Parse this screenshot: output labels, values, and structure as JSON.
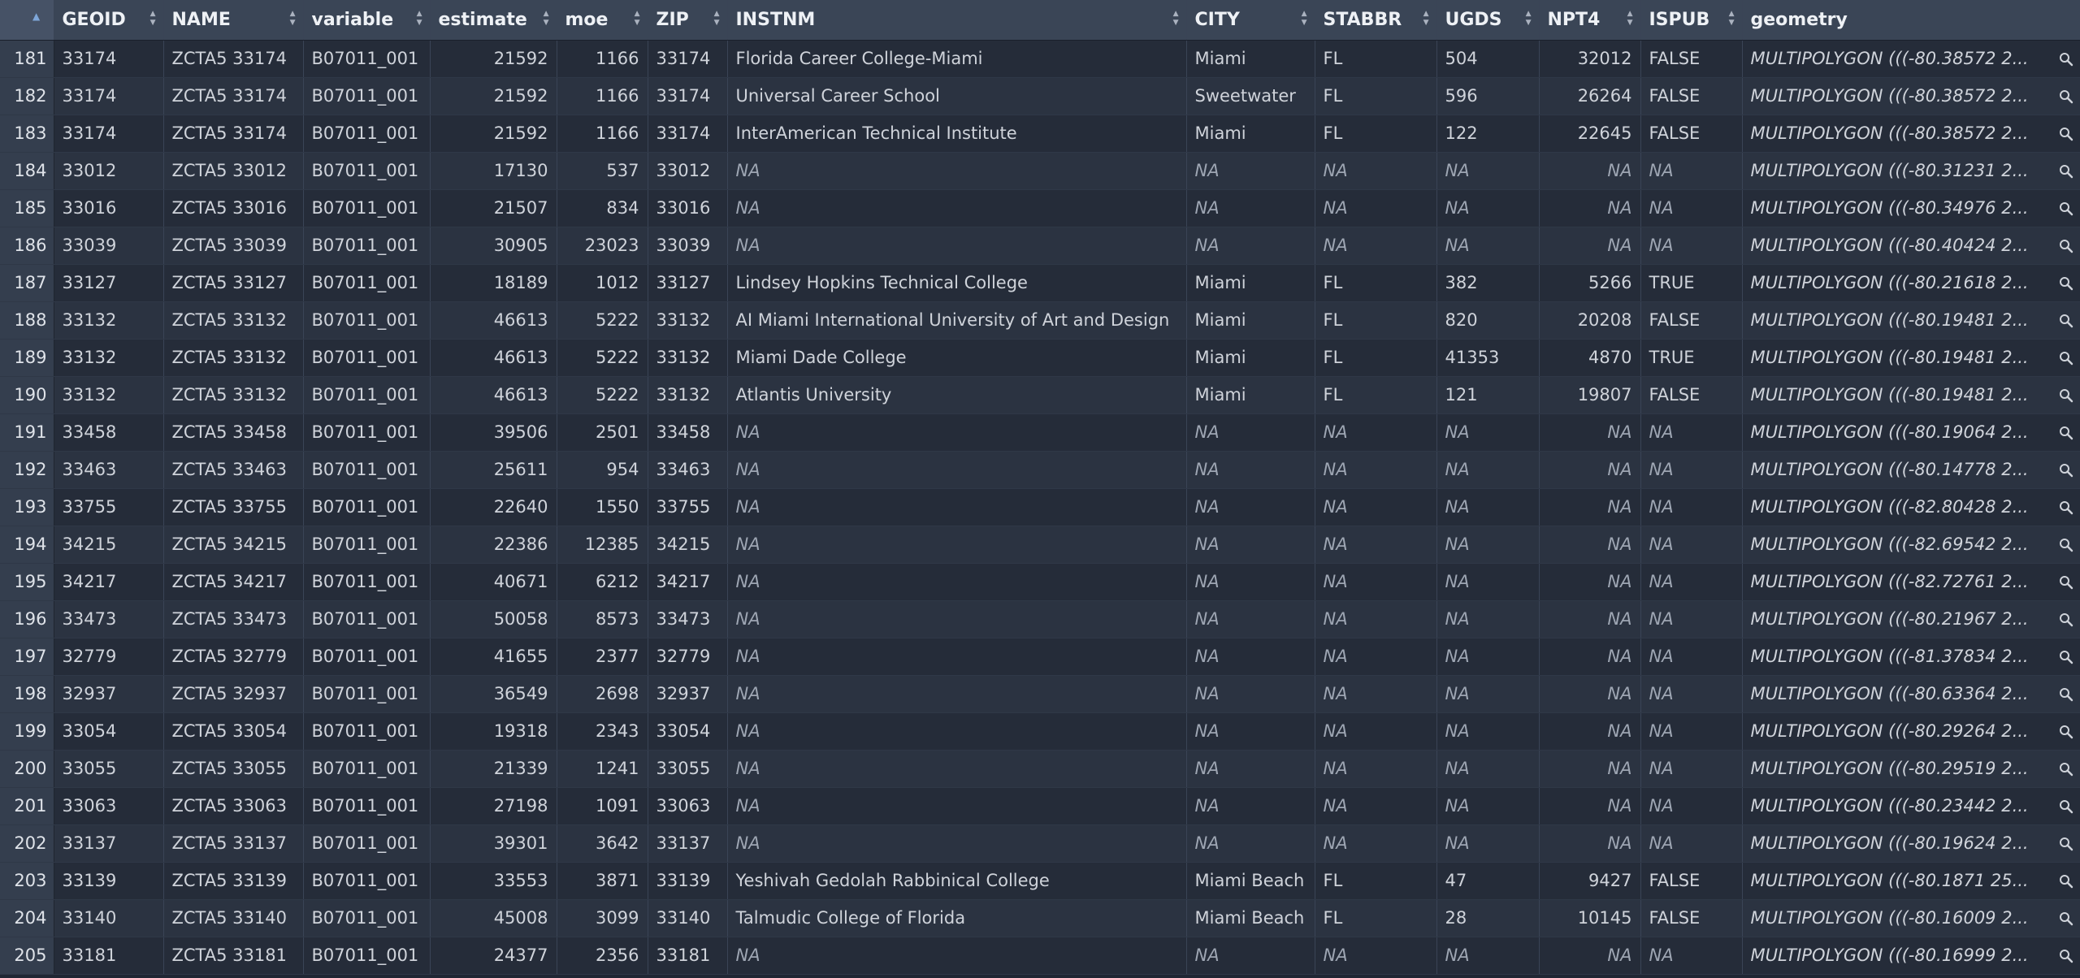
{
  "columns": [
    "GEOID",
    "NAME",
    "variable",
    "estimate",
    "moe",
    "ZIP",
    "INSTNM",
    "CITY",
    "STABBR",
    "UGDS",
    "NPT4",
    "ISPUB",
    "geometry"
  ],
  "icons": {
    "sort": "sort-arrows-icon",
    "sort_active": "sort-ascending-icon",
    "geometry_view": "magnifier-icon"
  },
  "rows": [
    {
      "idx": "181",
      "GEOID": "33174",
      "NAME": "ZCTA5 33174",
      "variable": "B07011_001",
      "estimate": "21592",
      "moe": "1166",
      "ZIP": "33174",
      "INSTNM": "Florida Career College-Miami",
      "CITY": "Miami",
      "STABBR": "FL",
      "UGDS": "504",
      "NPT4": "32012",
      "ISPUB": "FALSE",
      "geometry": "MULTIPOLYGON (((-80.38572 2..."
    },
    {
      "idx": "182",
      "GEOID": "33174",
      "NAME": "ZCTA5 33174",
      "variable": "B07011_001",
      "estimate": "21592",
      "moe": "1166",
      "ZIP": "33174",
      "INSTNM": "Universal Career School",
      "CITY": "Sweetwater",
      "STABBR": "FL",
      "UGDS": "596",
      "NPT4": "26264",
      "ISPUB": "FALSE",
      "geometry": "MULTIPOLYGON (((-80.38572 2..."
    },
    {
      "idx": "183",
      "GEOID": "33174",
      "NAME": "ZCTA5 33174",
      "variable": "B07011_001",
      "estimate": "21592",
      "moe": "1166",
      "ZIP": "33174",
      "INSTNM": "InterAmerican Technical Institute",
      "CITY": "Miami",
      "STABBR": "FL",
      "UGDS": "122",
      "NPT4": "22645",
      "ISPUB": "FALSE",
      "geometry": "MULTIPOLYGON (((-80.38572 2..."
    },
    {
      "idx": "184",
      "GEOID": "33012",
      "NAME": "ZCTA5 33012",
      "variable": "B07011_001",
      "estimate": "17130",
      "moe": "537",
      "ZIP": "33012",
      "INSTNM": "NA",
      "CITY": "NA",
      "STABBR": "NA",
      "UGDS": "NA",
      "NPT4": "NA",
      "ISPUB": "NA",
      "geometry": "MULTIPOLYGON (((-80.31231 2..."
    },
    {
      "idx": "185",
      "GEOID": "33016",
      "NAME": "ZCTA5 33016",
      "variable": "B07011_001",
      "estimate": "21507",
      "moe": "834",
      "ZIP": "33016",
      "INSTNM": "NA",
      "CITY": "NA",
      "STABBR": "NA",
      "UGDS": "NA",
      "NPT4": "NA",
      "ISPUB": "NA",
      "geometry": "MULTIPOLYGON (((-80.34976 2..."
    },
    {
      "idx": "186",
      "GEOID": "33039",
      "NAME": "ZCTA5 33039",
      "variable": "B07011_001",
      "estimate": "30905",
      "moe": "23023",
      "ZIP": "33039",
      "INSTNM": "NA",
      "CITY": "NA",
      "STABBR": "NA",
      "UGDS": "NA",
      "NPT4": "NA",
      "ISPUB": "NA",
      "geometry": "MULTIPOLYGON (((-80.40424 2..."
    },
    {
      "idx": "187",
      "GEOID": "33127",
      "NAME": "ZCTA5 33127",
      "variable": "B07011_001",
      "estimate": "18189",
      "moe": "1012",
      "ZIP": "33127",
      "INSTNM": "Lindsey Hopkins Technical College",
      "CITY": "Miami",
      "STABBR": "FL",
      "UGDS": "382",
      "NPT4": "5266",
      "ISPUB": "TRUE",
      "geometry": "MULTIPOLYGON (((-80.21618 2..."
    },
    {
      "idx": "188",
      "GEOID": "33132",
      "NAME": "ZCTA5 33132",
      "variable": "B07011_001",
      "estimate": "46613",
      "moe": "5222",
      "ZIP": "33132",
      "INSTNM": "AI Miami International University of Art and Design",
      "CITY": "Miami",
      "STABBR": "FL",
      "UGDS": "820",
      "NPT4": "20208",
      "ISPUB": "FALSE",
      "geometry": "MULTIPOLYGON (((-80.19481 2..."
    },
    {
      "idx": "189",
      "GEOID": "33132",
      "NAME": "ZCTA5 33132",
      "variable": "B07011_001",
      "estimate": "46613",
      "moe": "5222",
      "ZIP": "33132",
      "INSTNM": "Miami Dade College",
      "CITY": "Miami",
      "STABBR": "FL",
      "UGDS": "41353",
      "NPT4": "4870",
      "ISPUB": "TRUE",
      "geometry": "MULTIPOLYGON (((-80.19481 2..."
    },
    {
      "idx": "190",
      "GEOID": "33132",
      "NAME": "ZCTA5 33132",
      "variable": "B07011_001",
      "estimate": "46613",
      "moe": "5222",
      "ZIP": "33132",
      "INSTNM": "Atlantis University",
      "CITY": "Miami",
      "STABBR": "FL",
      "UGDS": "121",
      "NPT4": "19807",
      "ISPUB": "FALSE",
      "geometry": "MULTIPOLYGON (((-80.19481 2..."
    },
    {
      "idx": "191",
      "GEOID": "33458",
      "NAME": "ZCTA5 33458",
      "variable": "B07011_001",
      "estimate": "39506",
      "moe": "2501",
      "ZIP": "33458",
      "INSTNM": "NA",
      "CITY": "NA",
      "STABBR": "NA",
      "UGDS": "NA",
      "NPT4": "NA",
      "ISPUB": "NA",
      "geometry": "MULTIPOLYGON (((-80.19064 2..."
    },
    {
      "idx": "192",
      "GEOID": "33463",
      "NAME": "ZCTA5 33463",
      "variable": "B07011_001",
      "estimate": "25611",
      "moe": "954",
      "ZIP": "33463",
      "INSTNM": "NA",
      "CITY": "NA",
      "STABBR": "NA",
      "UGDS": "NA",
      "NPT4": "NA",
      "ISPUB": "NA",
      "geometry": "MULTIPOLYGON (((-80.14778 2..."
    },
    {
      "idx": "193",
      "GEOID": "33755",
      "NAME": "ZCTA5 33755",
      "variable": "B07011_001",
      "estimate": "22640",
      "moe": "1550",
      "ZIP": "33755",
      "INSTNM": "NA",
      "CITY": "NA",
      "STABBR": "NA",
      "UGDS": "NA",
      "NPT4": "NA",
      "ISPUB": "NA",
      "geometry": "MULTIPOLYGON (((-82.80428 2..."
    },
    {
      "idx": "194",
      "GEOID": "34215",
      "NAME": "ZCTA5 34215",
      "variable": "B07011_001",
      "estimate": "22386",
      "moe": "12385",
      "ZIP": "34215",
      "INSTNM": "NA",
      "CITY": "NA",
      "STABBR": "NA",
      "UGDS": "NA",
      "NPT4": "NA",
      "ISPUB": "NA",
      "geometry": "MULTIPOLYGON (((-82.69542 2..."
    },
    {
      "idx": "195",
      "GEOID": "34217",
      "NAME": "ZCTA5 34217",
      "variable": "B07011_001",
      "estimate": "40671",
      "moe": "6212",
      "ZIP": "34217",
      "INSTNM": "NA",
      "CITY": "NA",
      "STABBR": "NA",
      "UGDS": "NA",
      "NPT4": "NA",
      "ISPUB": "NA",
      "geometry": "MULTIPOLYGON (((-82.72761 2..."
    },
    {
      "idx": "196",
      "GEOID": "33473",
      "NAME": "ZCTA5 33473",
      "variable": "B07011_001",
      "estimate": "50058",
      "moe": "8573",
      "ZIP": "33473",
      "INSTNM": "NA",
      "CITY": "NA",
      "STABBR": "NA",
      "UGDS": "NA",
      "NPT4": "NA",
      "ISPUB": "NA",
      "geometry": "MULTIPOLYGON (((-80.21967 2..."
    },
    {
      "idx": "197",
      "GEOID": "32779",
      "NAME": "ZCTA5 32779",
      "variable": "B07011_001",
      "estimate": "41655",
      "moe": "2377",
      "ZIP": "32779",
      "INSTNM": "NA",
      "CITY": "NA",
      "STABBR": "NA",
      "UGDS": "NA",
      "NPT4": "NA",
      "ISPUB": "NA",
      "geometry": "MULTIPOLYGON (((-81.37834 2..."
    },
    {
      "idx": "198",
      "GEOID": "32937",
      "NAME": "ZCTA5 32937",
      "variable": "B07011_001",
      "estimate": "36549",
      "moe": "2698",
      "ZIP": "32937",
      "INSTNM": "NA",
      "CITY": "NA",
      "STABBR": "NA",
      "UGDS": "NA",
      "NPT4": "NA",
      "ISPUB": "NA",
      "geometry": "MULTIPOLYGON (((-80.63364 2..."
    },
    {
      "idx": "199",
      "GEOID": "33054",
      "NAME": "ZCTA5 33054",
      "variable": "B07011_001",
      "estimate": "19318",
      "moe": "2343",
      "ZIP": "33054",
      "INSTNM": "NA",
      "CITY": "NA",
      "STABBR": "NA",
      "UGDS": "NA",
      "NPT4": "NA",
      "ISPUB": "NA",
      "geometry": "MULTIPOLYGON (((-80.29264 2..."
    },
    {
      "idx": "200",
      "GEOID": "33055",
      "NAME": "ZCTA5 33055",
      "variable": "B07011_001",
      "estimate": "21339",
      "moe": "1241",
      "ZIP": "33055",
      "INSTNM": "NA",
      "CITY": "NA",
      "STABBR": "NA",
      "UGDS": "NA",
      "NPT4": "NA",
      "ISPUB": "NA",
      "geometry": "MULTIPOLYGON (((-80.29519 2..."
    },
    {
      "idx": "201",
      "GEOID": "33063",
      "NAME": "ZCTA5 33063",
      "variable": "B07011_001",
      "estimate": "27198",
      "moe": "1091",
      "ZIP": "33063",
      "INSTNM": "NA",
      "CITY": "NA",
      "STABBR": "NA",
      "UGDS": "NA",
      "NPT4": "NA",
      "ISPUB": "NA",
      "geometry": "MULTIPOLYGON (((-80.23442 2..."
    },
    {
      "idx": "202",
      "GEOID": "33137",
      "NAME": "ZCTA5 33137",
      "variable": "B07011_001",
      "estimate": "39301",
      "moe": "3642",
      "ZIP": "33137",
      "INSTNM": "NA",
      "CITY": "NA",
      "STABBR": "NA",
      "UGDS": "NA",
      "NPT4": "NA",
      "ISPUB": "NA",
      "geometry": "MULTIPOLYGON (((-80.19624 2..."
    },
    {
      "idx": "203",
      "GEOID": "33139",
      "NAME": "ZCTA5 33139",
      "variable": "B07011_001",
      "estimate": "33553",
      "moe": "3871",
      "ZIP": "33139",
      "INSTNM": "Yeshivah Gedolah Rabbinical College",
      "CITY": "Miami Beach",
      "STABBR": "FL",
      "UGDS": "47",
      "NPT4": "9427",
      "ISPUB": "FALSE",
      "geometry": "MULTIPOLYGON (((-80.1871 25..."
    },
    {
      "idx": "204",
      "GEOID": "33140",
      "NAME": "ZCTA5 33140",
      "variable": "B07011_001",
      "estimate": "45008",
      "moe": "3099",
      "ZIP": "33140",
      "INSTNM": "Talmudic College of Florida",
      "CITY": "Miami Beach",
      "STABBR": "FL",
      "UGDS": "28",
      "NPT4": "10145",
      "ISPUB": "FALSE",
      "geometry": "MULTIPOLYGON (((-80.16009 2..."
    },
    {
      "idx": "205",
      "GEOID": "33181",
      "NAME": "ZCTA5 33181",
      "variable": "B07011_001",
      "estimate": "24377",
      "moe": "2356",
      "ZIP": "33181",
      "INSTNM": "NA",
      "CITY": "NA",
      "STABBR": "NA",
      "UGDS": "NA",
      "NPT4": "NA",
      "ISPUB": "NA",
      "geometry": "MULTIPOLYGON (((-80.16999 2..."
    }
  ]
}
